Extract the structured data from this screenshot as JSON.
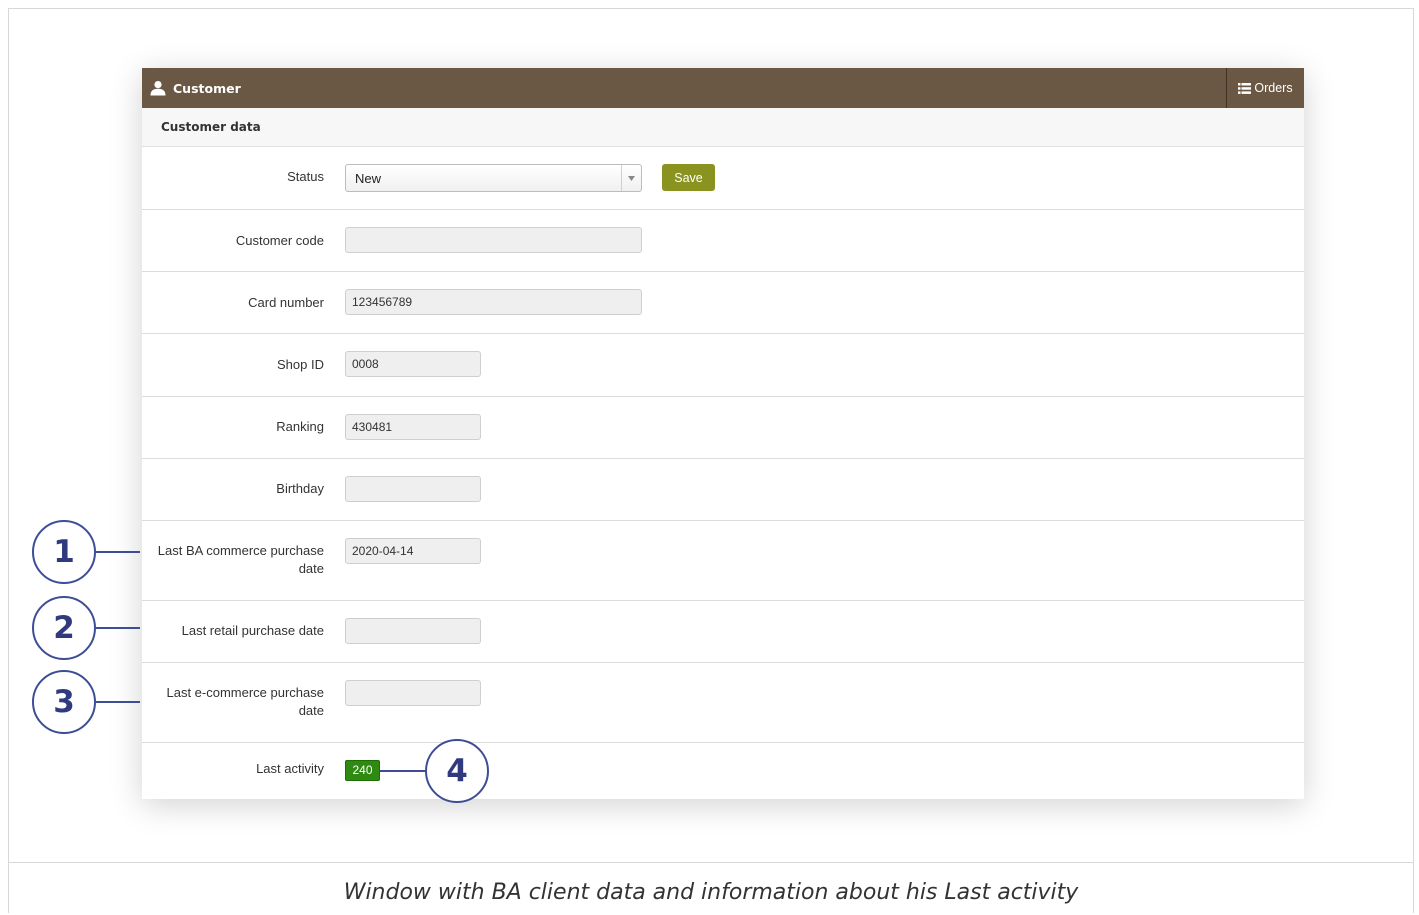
{
  "header": {
    "title": "Customer",
    "orders_label": "Orders"
  },
  "section_title": "Customer data",
  "form": {
    "status": {
      "label": "Status",
      "value": "New"
    },
    "save_label": "Save",
    "customer_code": {
      "label": "Customer code",
      "value": ""
    },
    "card_number": {
      "label": "Card number",
      "value": "123456789"
    },
    "shop_id": {
      "label": "Shop ID",
      "value": "0008"
    },
    "ranking": {
      "label": "Ranking",
      "value": "430481"
    },
    "birthday": {
      "label": "Birthday",
      "value": ""
    },
    "last_ba_purchase": {
      "label_line1": "Last BA commerce purchase",
      "label_line2": "date",
      "value": "2020-04-14"
    },
    "last_retail_purchase": {
      "label": "Last retail purchase date",
      "value": ""
    },
    "last_ecommerce_purchase": {
      "label_line1": "Last e-commerce purchase",
      "label_line2": "date",
      "value": ""
    },
    "last_activity": {
      "label": "Last activity",
      "value": "240"
    }
  },
  "callouts": [
    "1",
    "2",
    "3",
    "4"
  ],
  "caption": "Window with BA client data and information about his Last activity",
  "colors": {
    "header_bg": "#6b5844",
    "save_button": "#8a931f",
    "activity_badge": "#2f8a12",
    "callout_stroke": "#3d4d96"
  },
  "icons": {
    "header": "user-icon",
    "orders": "list-icon",
    "select": "caret-down-icon"
  }
}
